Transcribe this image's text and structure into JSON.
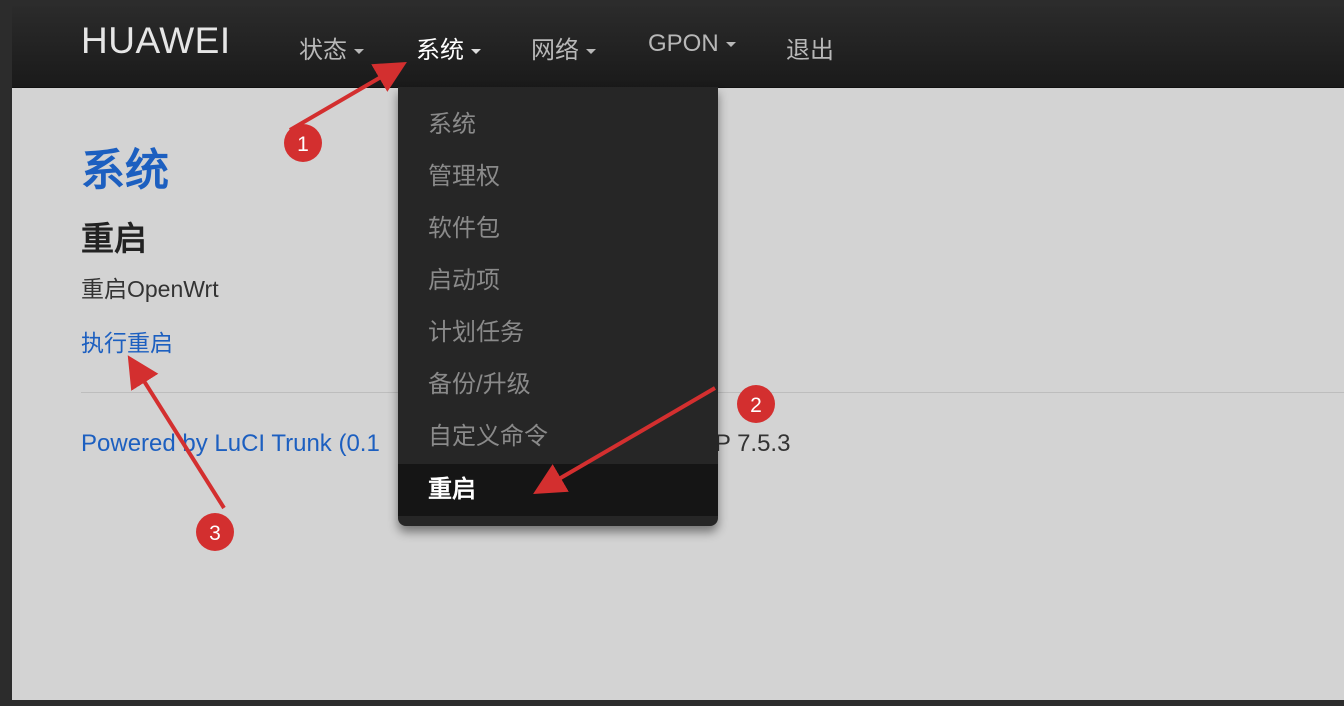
{
  "navbar": {
    "brand": "HUAWEI",
    "items": [
      {
        "label": "状态"
      },
      {
        "label": "系统"
      },
      {
        "label": "网络"
      },
      {
        "label": "GPON"
      },
      {
        "label": "退出"
      }
    ]
  },
  "dropdown": {
    "items": [
      "系统",
      "管理权",
      "软件包",
      "启动项",
      "计划任务",
      "备份/升级",
      "自定义命令",
      "重启"
    ],
    "selected": "重启"
  },
  "page": {
    "title": "系统",
    "section_title": "重启",
    "description": "重启OpenWrt",
    "action_link": "执行重启"
  },
  "footer": {
    "text_left": "Powered by LuCI Trunk (0.1",
    "text_right": "P 7.5.3"
  },
  "annotations": [
    {
      "label": "1"
    },
    {
      "label": "2"
    },
    {
      "label": "3"
    }
  ],
  "colors": {
    "link": "#1c5fc0",
    "navbar": "#1f1f1f",
    "annotation": "#d32f2f"
  }
}
